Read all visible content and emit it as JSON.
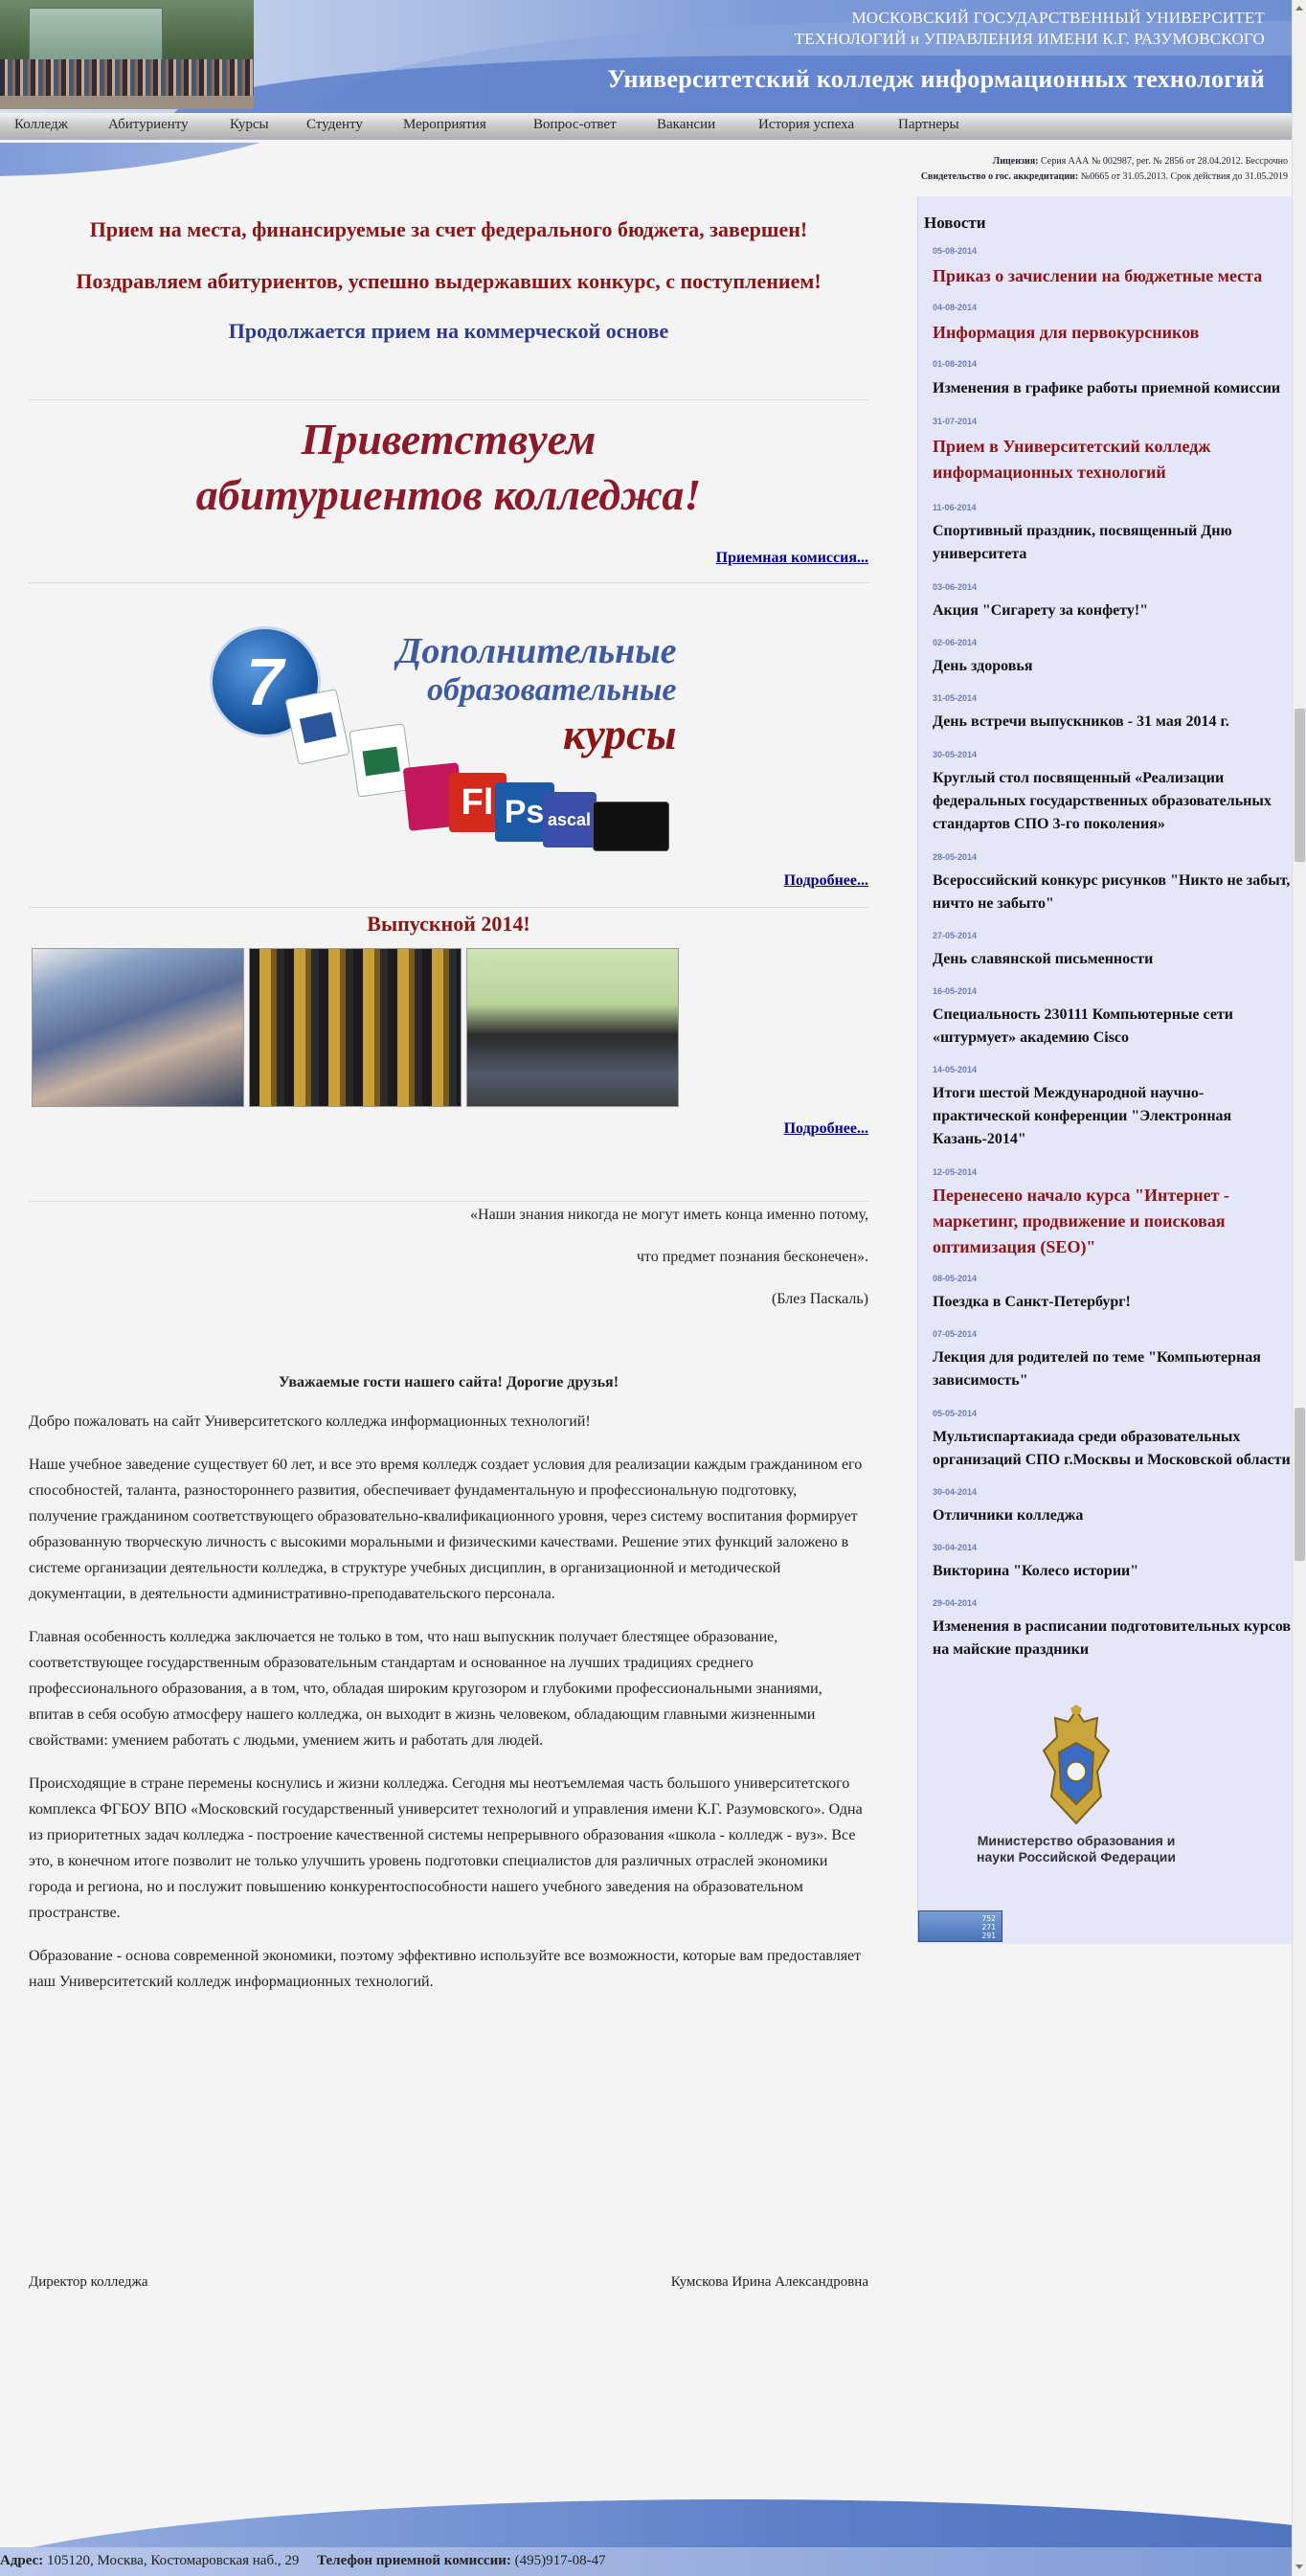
{
  "header": {
    "university_line1": "МОСКОВСКИЙ ГОСУДАРСТВЕННЫЙ УНИВЕРСИТЕТ",
    "university_line2": "ТЕХНОЛОГИЙ и УПРАВЛЕНИЯ ИМЕНИ К.Г. РАЗУМОВСКОГО",
    "college_name": "Университетский колледж информационных технологий"
  },
  "menu": [
    "Колледж",
    "Абитуриенту",
    "Курсы",
    "Студенту",
    "Мероприятия",
    "Вопрос-ответ",
    "Вакансии",
    "История успеха",
    "Партнеры"
  ],
  "license": {
    "line1_label": "Лицензия:",
    "line1_text": "Серия ААА № 002987, рег. № 2856 от 28.04.2012. Бессрочно",
    "line2_label": "Свидетельство о гос. аккредитации:",
    "line2_text": "№0665 от 31.05.2013. Срок действия до 31.05.2019"
  },
  "main": {
    "announce1": "Прием на места, финансируемые за счет федерального бюджета, завершен!",
    "announce2": "Поздравляем абитуриентов, успешно выдержавших конкурс, с поступлением!",
    "announce3": "Продолжается прием на коммерческой основе",
    "greeting_line1": "Приветствуем",
    "greeting_line2": "абитуриентов колледжа!",
    "admissions_link": "Приемная комиссия...",
    "courses_banner": {
      "logo_number": "7",
      "line1": "Дополнительные",
      "line2": "образовательные",
      "line3": "курсы",
      "tile_fl": "Fl",
      "tile_ps": "Ps",
      "tile_pascal": "ascal"
    },
    "more_link_1": "Подробнее...",
    "graduation_title": "Выпускной 2014!",
    "more_link_2": "Подробнее...",
    "quote_line1": "«Наши знания никогда не могут иметь конца именно потому,",
    "quote_line2": "что предмет познания бесконечен».",
    "quote_author": "(Блез Паскаль)",
    "welcome_heading": "Уважаемые гости нашего сайта! Дорогие друзья!",
    "paragraphs": [
      "Добро пожаловать на сайт Университетского колледжа информационных технологий!",
      "Наше учебное заведение существует  60 лет, и все это время колледж создает условия для реализации каждым гражданином его способностей, таланта, разностороннего развития, обеспечивает фундаментальную и профессиональную подготовку, получение гражданином соответствующего образовательно-квалификационного уровня, через систему воспитания формирует образованную творческую личность с высокими моральными и физическими качествами. Решение этих функций заложено в системе организации деятельности колледжа, в структуре учебных дисциплин, в организационной и методической документации, в деятельности административно-преподавательского персонала.",
      "Главная особенность колледжа заключается не только в том, что наш выпускник получает блестящее образование, соответствующее государственным образовательным стандартам и основанное на лучших традициях среднего профессионального образования, а в том, что, обладая широким кругозором и глубокими профессиональными знаниями, впитав в себя особую атмосферу нашего колледжа, он выходит в жизнь человеком, обладающим главными жизненными свойствами: умением работать с людьми, умением жить и работать для людей.",
      " Происходящие в стране перемены коснулись и жизни колледжа. Сегодня мы неотъемлемая часть большого университетского комплекса ФГБОУ ВПО «Московский государственный университет технологий и управления имени К.Г. Разумовского». Одна из приоритетных задач колледжа - построение качественной системы непрерывного образования «школа - колледж - вуз». Все это, в конечном итоге позволит не только улучшить уровень подготовки специалистов для различных отраслей экономики города и региона, но и послужит повышению конкурентоспособности нашего учебного заведения на образовательном пространстве.",
      "Образование - основа современной экономики, поэтому эффективно используйте все возможности, которые вам предоставляет наш Университетский колледж информационных технологий."
    ],
    "director_label": "Директор колледжа",
    "director_name": "Кумскова Ирина Александровна"
  },
  "sidebar": {
    "title": "Новости",
    "news": [
      {
        "date": "05-08-2014",
        "title": "Приказ о зачислении на бюджетные места",
        "highlight": true
      },
      {
        "date": "04-08-2014",
        "title": "Информация для первокурсников",
        "highlight": true
      },
      {
        "date": "01-08-2014",
        "title": "Изменения в графике работы приемной комиссии",
        "highlight": false
      },
      {
        "date": "31-07-2014",
        "title": "Прием в Университетский колледж информационных технологий",
        "highlight": true
      },
      {
        "date": "11-06-2014",
        "title": "Спортивный праздник, посвященный Дню университета",
        "highlight": false
      },
      {
        "date": "03-06-2014",
        "title": "Акция \"Сигарету за конфету!\"",
        "highlight": false
      },
      {
        "date": "02-06-2014",
        "title": "День здоровья",
        "highlight": false
      },
      {
        "date": "31-05-2014",
        "title": "День встречи выпускников - 31 мая 2014 г.",
        "highlight": false
      },
      {
        "date": "30-05-2014",
        "title": "Круглый стол посвященный «Реализации федеральных государственных образовательных стандартов СПО 3-го поколения»",
        "highlight": false
      },
      {
        "date": "28-05-2014",
        "title": "Всероссийский конкурс рисунков \"Никто не забыт, ничто не забыто\"",
        "highlight": false
      },
      {
        "date": "27-05-2014",
        "title": "День славянской письменности",
        "highlight": false
      },
      {
        "date": "16-05-2014",
        "title": "Специальность 230111 Компьютерные сети «штурмует» академию Cisco",
        "highlight": false
      },
      {
        "date": "14-05-2014",
        "title": "Итоги шестой Международной научно-практической конференции \"Электронная Казань-2014\"",
        "highlight": false
      },
      {
        "date": "12-05-2014",
        "title": "Перенесено начало курса \"Интернет - маркетинг, продвижение и поисковая оптимизация (SEO)\"",
        "highlight": true
      },
      {
        "date": "08-05-2014",
        "title": "Поездка в Санкт-Петербург!",
        "highlight": false
      },
      {
        "date": "07-05-2014",
        "title": "Лекция для родителей по теме \"Компьютерная зависимость\"",
        "highlight": false
      },
      {
        "date": "05-05-2014",
        "title": "Мультиспартакиада среди образовательных организаций СПО г.Москвы и Московской области",
        "highlight": false
      },
      {
        "date": "30-04-2014",
        "title": "Отличники колледжа",
        "highlight": false
      },
      {
        "date": "30-04-2014",
        "title": "Викторина \"Колесо истории\"",
        "highlight": false
      },
      {
        "date": "29-04-2014",
        "title": "Изменения в расписании подготовительных курсов на майские праздники",
        "highlight": false
      }
    ],
    "ministry_text": "Министерство образования и науки Российской Федерации",
    "counter": [
      "752",
      "271",
      "291"
    ]
  },
  "footer": {
    "address_label": "Адрес:",
    "address": "105120, Москва, Костомаровская наб., 29",
    "phone_label": "Телефон приемной комиссии:",
    "phone": "(495)917-08-47"
  },
  "colors": {
    "accent_red": "#8b1414",
    "accent_blue": "#2e3a8c",
    "sidebar_bg": "#e6e6fa",
    "header_blue": "#6f8fd3"
  }
}
